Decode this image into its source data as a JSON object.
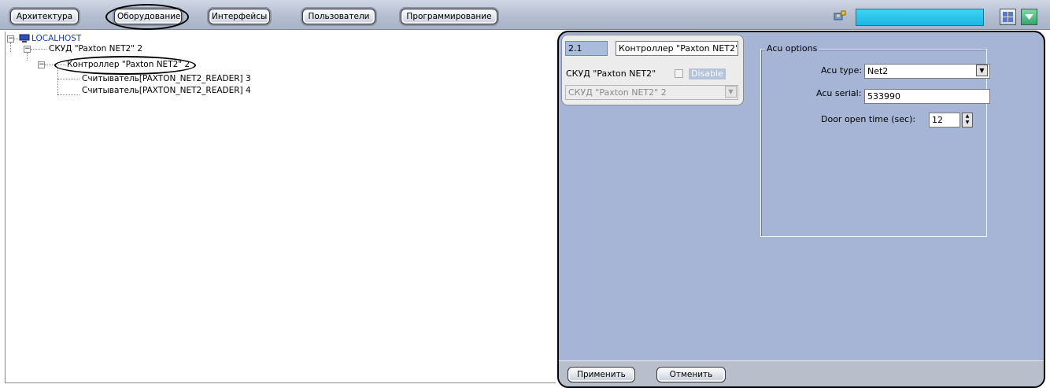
{
  "toolbar": {
    "tabs": [
      {
        "label": "Архитектура"
      },
      {
        "label": "Оборудование",
        "active": true
      },
      {
        "label": "Интерфейсы"
      },
      {
        "label": "Пользователи"
      },
      {
        "label": "Программирование"
      }
    ],
    "search_value": "",
    "icons": [
      "user-config-icon",
      "layout-grid-icon",
      "dropdown-arrow-icon"
    ],
    "accent_color": "#22bfe8"
  },
  "tree": {
    "root": {
      "label": "LOCALHOST",
      "icon": "computer-icon",
      "color": "#1a3fb0"
    },
    "skud": {
      "label": "СКУД \"Paxton NET2\" 2"
    },
    "controller": {
      "label": "Контроллер \"Paxton NET2\" 2",
      "selected": true
    },
    "readers": [
      {
        "label": "Считыватель[PAXTON_NET2_READER] 3"
      },
      {
        "label": "Считыватель[PAXTON_NET2_READER] 4"
      }
    ]
  },
  "object_card": {
    "id_value": "2.1",
    "name_value": "Контроллер \"Paxton NET2\"",
    "parent_label": "СКУД \"Paxton NET2\"",
    "disable_label": "Disable",
    "parent_select_value": "СКУД \"Paxton NET2\" 2"
  },
  "acu_options": {
    "legend": "Acu options",
    "type_label": "Acu type:",
    "type_value": "Net2",
    "serial_label": "Acu serial:",
    "serial_value": "533990",
    "door_label": "Door open time (sec):",
    "door_value": "12"
  },
  "actions": {
    "apply_label": "Применить",
    "cancel_label": "Отменить"
  },
  "colors": {
    "panel_bg": "#a6b5d6",
    "toolbar_bg": "#b3bdd0"
  }
}
